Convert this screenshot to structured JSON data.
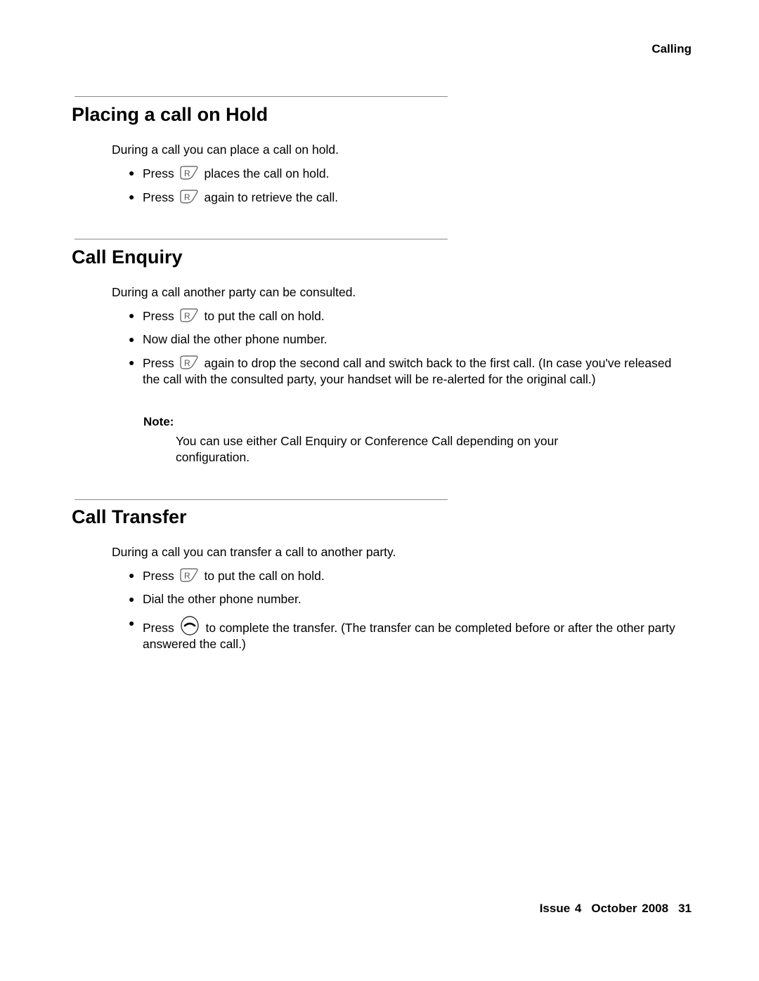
{
  "header": {
    "section": "Calling"
  },
  "sections": [
    {
      "title": "Placing a call on Hold",
      "intro": "During a call you can place a call on hold.",
      "bullets": [
        {
          "pre": "Press",
          "icon": "r-key-icon",
          "post": "places the call on hold."
        },
        {
          "pre": "Press",
          "icon": "r-key-icon",
          "post": "again to retrieve the call."
        }
      ]
    },
    {
      "title": "Call Enquiry",
      "intro": "During a call another party can be consulted.",
      "bullets": [
        {
          "pre": "Press",
          "icon": "r-key-icon",
          "post": "to put the call on hold."
        },
        {
          "pre": "",
          "icon": "",
          "post": "Now dial the other phone number."
        },
        {
          "pre": "Press",
          "icon": "r-key-icon",
          "post": "again to drop the second call and switch back to the first call. (In case you've released the call with the consulted party, your handset will be re-alerted for the original call.)"
        }
      ],
      "note": {
        "label": "Note:",
        "text": "You can use either Call Enquiry or Conference Call depending on your configuration."
      }
    },
    {
      "title": "Call Transfer",
      "intro": "During a call you can transfer a call to another party.",
      "bullets": [
        {
          "pre": "Press",
          "icon": "r-key-icon",
          "post": "to put the call on hold."
        },
        {
          "pre": "",
          "icon": "",
          "post": "Dial the other phone number."
        },
        {
          "pre": "Press",
          "icon": "end-call-key-icon",
          "post": "to complete the transfer. (The transfer can be completed before or after the other party answered the call.)"
        }
      ]
    }
  ],
  "footer": {
    "issue": "Issue 4",
    "date": "October 2008",
    "page": "31"
  }
}
